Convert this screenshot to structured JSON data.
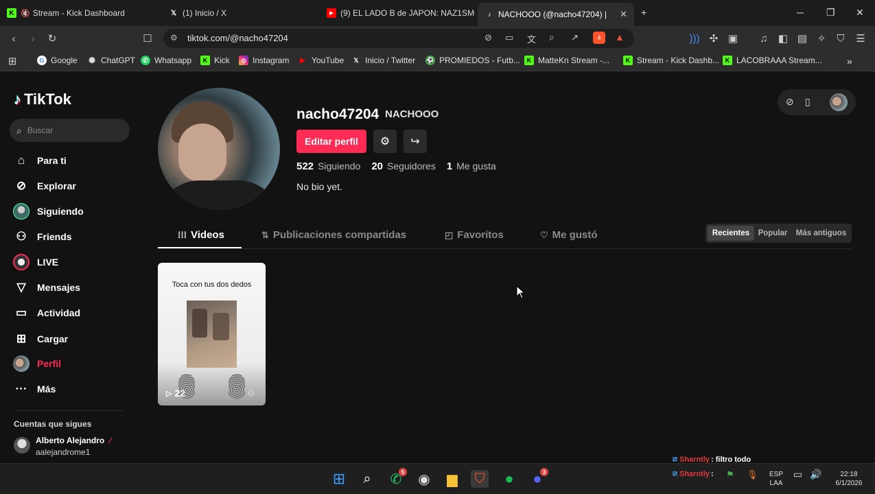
{
  "browser": {
    "tabs": [
      {
        "title": "Stream - Kick Dashboard",
        "icon": "kick-icon"
      },
      {
        "title": "(1) Inicio / X",
        "icon": "x-icon"
      },
      {
        "title": "(9) EL LADO B de JAPON: NAZ1SMO...",
        "icon": "youtube-icon"
      },
      {
        "title": "NACHOOO (@nacho47204) | Tik...",
        "icon": "tiktok-icon"
      }
    ],
    "new_tab": "+",
    "url": "tiktok.com/@nacho47204",
    "shields_count": "4",
    "bookmarks": [
      "Google",
      "ChatGPT",
      "Whatsapp",
      "Kick",
      "Instagram",
      "YouTube",
      "Inicio / Twitter",
      "PROMIEDOS - Futb...",
      "MatteKn Stream -...",
      "Stream - Kick Dashb...",
      "LACOBRAAA Stream..."
    ]
  },
  "tiktok": {
    "logo": "TikTok",
    "search_placeholder": "Buscar",
    "nav": [
      {
        "label": "Para ti",
        "icon": "home-icon"
      },
      {
        "label": "Explorar",
        "icon": "compass-icon"
      },
      {
        "label": "Siguiendo",
        "icon": "following-avatar-icon"
      },
      {
        "label": "Friends",
        "icon": "friends-icon"
      },
      {
        "label": "LIVE",
        "icon": "live-icon"
      },
      {
        "label": "Mensajes",
        "icon": "messages-icon"
      },
      {
        "label": "Actividad",
        "icon": "activity-icon"
      },
      {
        "label": "Cargar",
        "icon": "upload-icon"
      },
      {
        "label": "Perfil",
        "icon": "profile-avatar-icon"
      },
      {
        "label": "Más",
        "icon": "more-icon"
      }
    ],
    "following_section_title": "Cuentas que sigues",
    "followed_account": {
      "name": "Alberto Alejandro",
      "handle": "aalejandrome1"
    },
    "profile": {
      "username": "nacho47204",
      "nickname": "NACHOOO",
      "edit_button": "Editar perfil",
      "following_count": "522",
      "following_label": "Siguiendo",
      "followers_count": "20",
      "followers_label": "Seguidores",
      "likes_count": "1",
      "likes_label": "Me gusta",
      "bio": "No bio yet."
    },
    "profile_tabs": [
      "Videos",
      "Publicaciones compartidas",
      "Favoritos",
      "Me gustó"
    ],
    "sort_options": [
      "Recientes",
      "Popular",
      "Más antiguos"
    ],
    "sort_selected": "Recientes",
    "videos": [
      {
        "caption": "Toca con tus dos dedos",
        "plays": "22"
      }
    ]
  },
  "stream_overlay": [
    {
      "user": "Sharntly",
      "message": ": filtro todo"
    },
    {
      "user": "Sharntly",
      "message": ":"
    }
  ],
  "taskbar": {
    "apps": [
      {
        "name": "windows-start-icon"
      },
      {
        "name": "search-icon"
      },
      {
        "name": "whatsapp-icon",
        "badge": "5"
      },
      {
        "name": "obs-icon"
      },
      {
        "name": "file-explorer-icon"
      },
      {
        "name": "brave-icon"
      },
      {
        "name": "spotify-icon"
      },
      {
        "name": "discord-icon",
        "badge": "3"
      }
    ],
    "language": "ESP",
    "layout": "LAA",
    "time": "22:18",
    "date": "6/1/2026"
  },
  "colors": {
    "accent": "#fe2c55",
    "background": "#121212"
  }
}
